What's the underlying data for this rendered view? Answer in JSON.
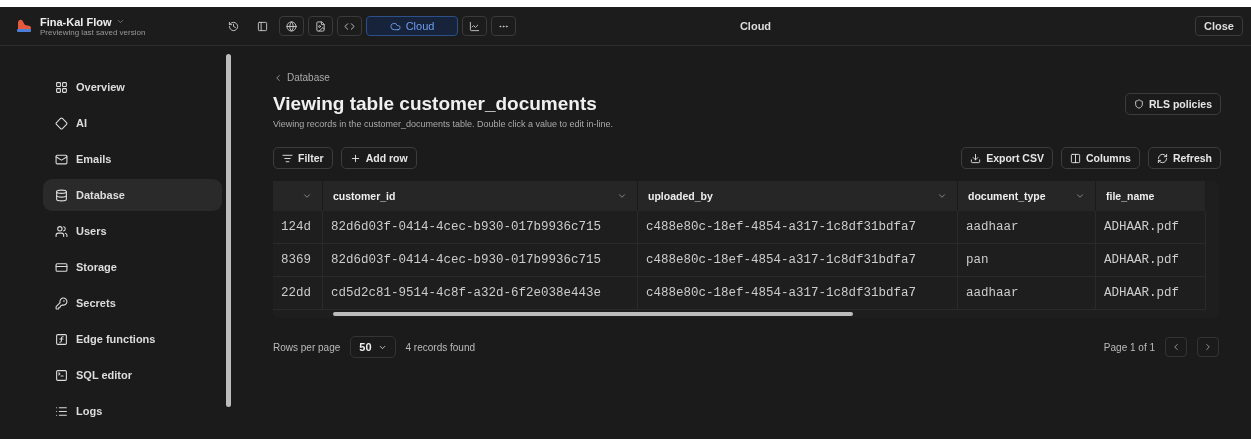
{
  "header": {
    "app_name": "Fina-Kal Flow",
    "subtitle": "Previewing last saved version",
    "tools": [
      {
        "kind": "history",
        "selected": false
      },
      {
        "kind": "panel",
        "selected": false
      },
      {
        "kind": "globe",
        "selected": false
      },
      {
        "kind": "image",
        "selected": false
      },
      {
        "kind": "code",
        "selected": false
      },
      {
        "kind": "cloud",
        "label": "Cloud",
        "selected": true
      },
      {
        "kind": "chart",
        "selected": false
      },
      {
        "kind": "more",
        "selected": false
      }
    ],
    "title": "Cloud",
    "close": "Close"
  },
  "sidebar": {
    "items": [
      {
        "kind": "overview",
        "label": "Overview",
        "selected": false
      },
      {
        "kind": "ai",
        "label": "AI",
        "selected": false
      },
      {
        "kind": "mail",
        "label": "Emails",
        "selected": false
      },
      {
        "kind": "database",
        "label": "Database",
        "selected": true
      },
      {
        "kind": "users",
        "label": "Users",
        "selected": false
      },
      {
        "kind": "storage",
        "label": "Storage",
        "selected": false
      },
      {
        "kind": "key",
        "label": "Secrets",
        "selected": false
      },
      {
        "kind": "function",
        "label": "Edge functions",
        "selected": false
      },
      {
        "kind": "terminal",
        "label": "SQL editor",
        "selected": false
      },
      {
        "kind": "logs",
        "label": "Logs",
        "selected": false
      }
    ]
  },
  "main": {
    "breadcrumb": "Database",
    "title": "Viewing table customer_documents",
    "description": "Viewing records in the customer_documents table. Double click a value to edit in-line.",
    "rls_button": "RLS policies",
    "left_actions": [
      {
        "kind": "filter",
        "label": "Filter"
      },
      {
        "kind": "plus",
        "label": "Add row"
      }
    ],
    "right_actions": [
      {
        "kind": "download",
        "label": "Export CSV"
      },
      {
        "kind": "columns",
        "label": "Columns"
      },
      {
        "kind": "refresh",
        "label": "Refresh"
      }
    ],
    "table": {
      "columns": [
        {
          "menu": true
        },
        {
          "label": "customer_id",
          "menu": true
        },
        {
          "label": "uploaded_by",
          "menu": true
        },
        {
          "label": "document_type",
          "menu": true
        },
        {
          "label": "file_name",
          "menu": false
        }
      ],
      "rows": [
        [
          "124d",
          "82d6d03f-0414-4cec-b930-017b9936c715",
          "c488e80c-18ef-4854-a317-1c8df31bdfa7",
          "aadhaar",
          "ADHAAR.pdf"
        ],
        [
          "8369",
          "82d6d03f-0414-4cec-b930-017b9936c715",
          "c488e80c-18ef-4854-a317-1c8df31bdfa7",
          "pan",
          "ADHAAR.pdf"
        ],
        [
          "22dd",
          "cd5d2c81-9514-4c8f-a32d-6f2e038e443e",
          "c488e80c-18ef-4854-a317-1c8df31bdfa7",
          "aadhaar",
          "ADHAAR.pdf"
        ]
      ]
    },
    "footer": {
      "rows_label": "Rows per page",
      "rows_value": "50",
      "records": "4 records found",
      "page": "Page 1 of 1"
    }
  }
}
